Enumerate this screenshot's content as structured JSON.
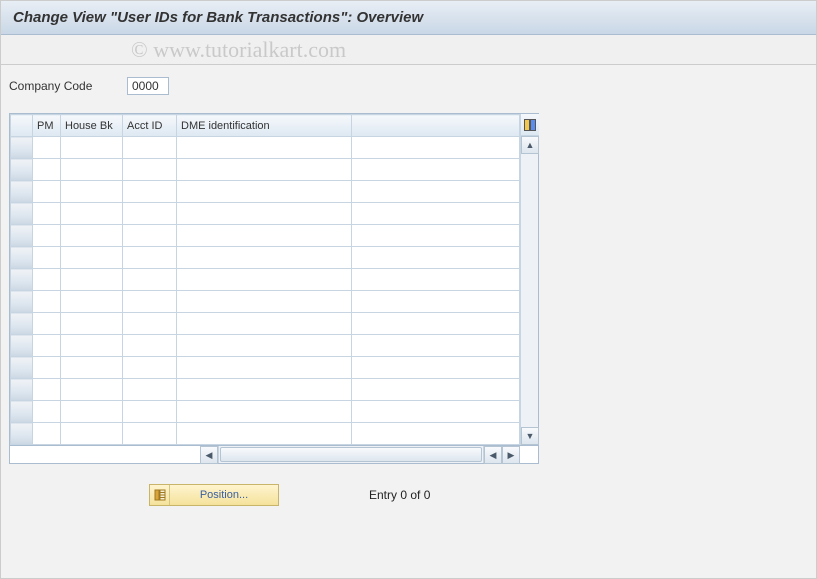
{
  "title": "Change View \"User IDs for Bank Transactions\": Overview",
  "watermark": "© www.tutorialkart.com",
  "company_code": {
    "label": "Company Code",
    "value": "0000"
  },
  "table": {
    "headers": {
      "pm": "PM",
      "house_bk": "House Bk",
      "acct_id": "Acct ID",
      "dme": "DME identification"
    },
    "rows": [
      {},
      {},
      {},
      {},
      {},
      {},
      {},
      {},
      {},
      {},
      {},
      {},
      {},
      {}
    ]
  },
  "footer": {
    "position_label": "Position...",
    "entry_status": "Entry 0 of 0"
  }
}
